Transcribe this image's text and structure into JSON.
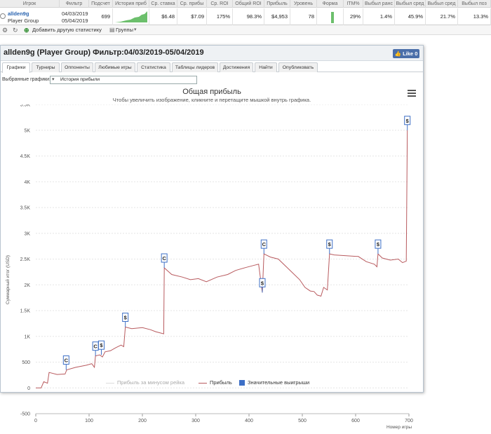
{
  "stats_table": {
    "headers": [
      "Игрок",
      "Фильтр",
      "Подсчет",
      "История приб",
      "Ср. ставка",
      "Ср. прибы",
      "Ср. ROI",
      "Общий ROI",
      "Прибыль",
      "Уровень",
      "Форма",
      "ITM%",
      "Выбыл ранс",
      "Выбыл сред",
      "Выбыл сред",
      "Выбыл поз"
    ],
    "row": {
      "player_name": "allden9g",
      "player_group": "Player Group",
      "filter_from": "04/03/2019",
      "filter_to": "05/04/2019",
      "count": "699",
      "avg_stake": "$6.48",
      "avg_profit": "$7.09",
      "avg_roi": "175%",
      "total_roi": "98.3%",
      "profit": "$4,953",
      "level": "78",
      "itm": "29%",
      "early_out": "1.4%",
      "mid_out": "45.9%",
      "mid_out2": "21.7%",
      "late_out": "13.3%"
    }
  },
  "toolbar": {
    "add_stat_label": "Добавить другую статистику",
    "groups_label": "Группы"
  },
  "panel": {
    "title": "allden9g (Player Group) Фильтр:04/03/2019-05/04/2019",
    "like_label": "Like",
    "like_count": "0",
    "tabs": [
      "Графики",
      "Турниры",
      "Оппоненты",
      "Любимые игры",
      "Статистика",
      "Таблицы лидеров",
      "Достижения",
      "Найти",
      "Опубликовать"
    ],
    "active_tab": "Графики",
    "selected_charts_label": "Выбранные графики:",
    "selected_chart_value": "История прибыли"
  },
  "chart": {
    "title": "Общая прибыль",
    "subtitle": "Чтобы увеличить изображение, кликните и перетащите мышкой внутрь графика.",
    "ylabel": "Суммарный итог (USD)",
    "xlabel": "Номер игры",
    "y_ticks": [
      "-500",
      "0",
      "500",
      "1K",
      "1.5K",
      "2K",
      "2.5K",
      "3K",
      "3.5K",
      "4K",
      "4.5K",
      "5K",
      "5.5K"
    ],
    "x_ticks": [
      "0",
      "100",
      "200",
      "300",
      "400",
      "500",
      "600",
      "700"
    ],
    "legend": [
      "Прибыль за минусом рейка",
      "Прибыль",
      "Значительные выигрыши"
    ],
    "colors": {
      "profit": "#b85a5e",
      "rake_line": "#dddddd",
      "big_wins": "#3d6fc6"
    }
  },
  "chart_data": {
    "type": "line",
    "title": "Общая прибыль",
    "xlabel": "Номер игры",
    "ylabel": "Суммарный итог (USD)",
    "xlim": [
      0,
      700
    ],
    "ylim": [
      -500,
      5500
    ],
    "grid": true,
    "legend_position": "bottom",
    "series": [
      {
        "name": "Прибыль",
        "points": [
          [
            0,
            0
          ],
          [
            10,
            0
          ],
          [
            15,
            120
          ],
          [
            22,
            90
          ],
          [
            25,
            300
          ],
          [
            40,
            260
          ],
          [
            55,
            270
          ],
          [
            58,
            350
          ],
          [
            75,
            400
          ],
          [
            95,
            440
          ],
          [
            105,
            470
          ],
          [
            110,
            400
          ],
          [
            112,
            620
          ],
          [
            120,
            640
          ],
          [
            125,
            600
          ],
          [
            130,
            700
          ],
          [
            140,
            720
          ],
          [
            150,
            780
          ],
          [
            160,
            830
          ],
          [
            165,
            800
          ],
          [
            168,
            1180
          ],
          [
            180,
            1150
          ],
          [
            200,
            1170
          ],
          [
            215,
            1130
          ],
          [
            225,
            1090
          ],
          [
            240,
            1050
          ],
          [
            241,
            2330
          ],
          [
            255,
            2200
          ],
          [
            275,
            2150
          ],
          [
            290,
            2100
          ],
          [
            305,
            2120
          ],
          [
            320,
            2060
          ],
          [
            340,
            2150
          ],
          [
            360,
            2200
          ],
          [
            375,
            2280
          ],
          [
            395,
            2340
          ],
          [
            410,
            2380
          ],
          [
            418,
            2400
          ],
          [
            425,
            1850
          ],
          [
            428,
            2600
          ],
          [
            440,
            2540
          ],
          [
            455,
            2500
          ],
          [
            470,
            2350
          ],
          [
            480,
            2250
          ],
          [
            495,
            2100
          ],
          [
            505,
            1950
          ],
          [
            515,
            1880
          ],
          [
            522,
            1870
          ],
          [
            528,
            1800
          ],
          [
            535,
            1780
          ],
          [
            540,
            1950
          ],
          [
            547,
            1900
          ],
          [
            551,
            2600
          ],
          [
            560,
            2580
          ],
          [
            575,
            2570
          ],
          [
            590,
            2560
          ],
          [
            605,
            2550
          ],
          [
            620,
            2450
          ],
          [
            635,
            2400
          ],
          [
            640,
            2350
          ],
          [
            642,
            2600
          ],
          [
            650,
            2520
          ],
          [
            665,
            2480
          ],
          [
            680,
            2500
          ],
          [
            688,
            2430
          ],
          [
            695,
            2460
          ],
          [
            697,
            5000
          ]
        ]
      }
    ],
    "big_wins": [
      {
        "x": 57,
        "y": 350,
        "label": "C"
      },
      {
        "x": 112,
        "y": 620,
        "label": "C"
      },
      {
        "x": 123,
        "y": 640,
        "label": "$"
      },
      {
        "x": 168,
        "y": 1180,
        "label": "$"
      },
      {
        "x": 241,
        "y": 2330,
        "label": "C"
      },
      {
        "x": 425,
        "y": 1850,
        "label": "$"
      },
      {
        "x": 428,
        "y": 2600,
        "label": "C"
      },
      {
        "x": 551,
        "y": 2600,
        "label": "$"
      },
      {
        "x": 642,
        "y": 2600,
        "label": "$"
      },
      {
        "x": 697,
        "y": 5000,
        "label": "$"
      }
    ]
  }
}
